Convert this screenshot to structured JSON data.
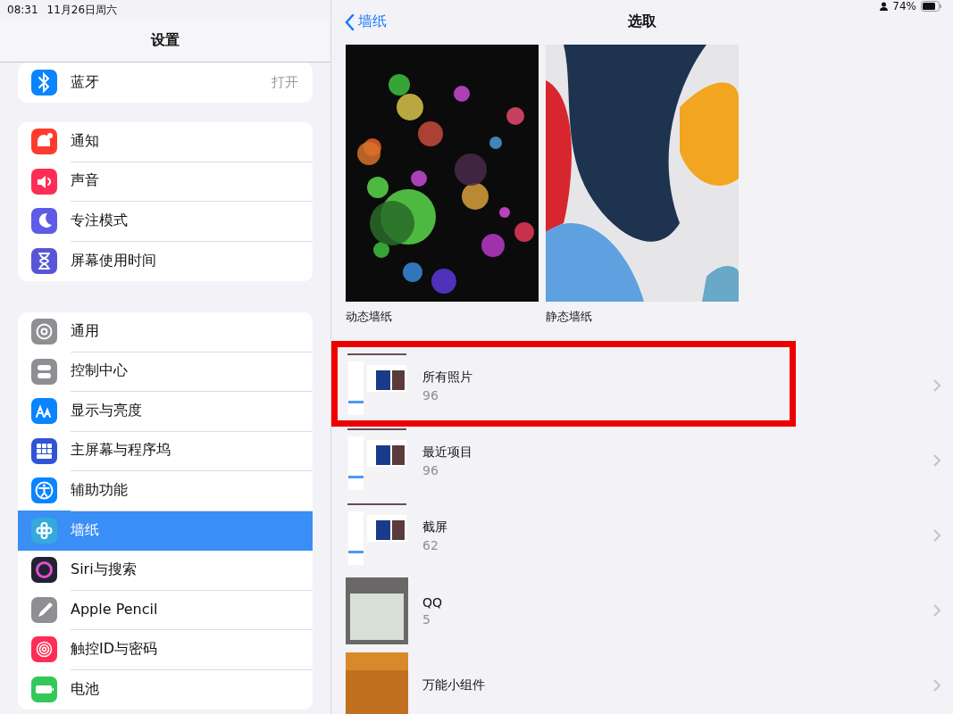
{
  "status_bar": {
    "time": "08:31",
    "date": "11月26日周六",
    "battery": "74%"
  },
  "sidebar": {
    "title": "设置",
    "groups": [
      {
        "items": [
          {
            "label": "蓝牙",
            "value": "打开",
            "color": "#0a84ff",
            "selected": false
          }
        ]
      },
      {
        "items": [
          {
            "label": "通知",
            "color": "#ff3b30",
            "selected": false
          },
          {
            "label": "声音",
            "color": "#ff2d55",
            "selected": false
          },
          {
            "label": "专注模式",
            "color": "#5e5ce6",
            "selected": false
          },
          {
            "label": "屏幕使用时间",
            "color": "#5856d6",
            "selected": false
          }
        ]
      },
      {
        "items": [
          {
            "label": "通用",
            "color": "#8e8e93",
            "selected": false
          },
          {
            "label": "控制中心",
            "color": "#8e8e93",
            "selected": false
          },
          {
            "label": "显示与亮度",
            "color": "#0a84ff",
            "selected": false
          },
          {
            "label": "主屏幕与程序坞",
            "color": "#2f54d6",
            "selected": false
          },
          {
            "label": "辅助功能",
            "color": "#0a84ff",
            "selected": false
          },
          {
            "label": "墙纸",
            "color": "#35a9dc",
            "selected": true
          },
          {
            "label": "Siri与搜索",
            "color": "#222233",
            "selected": false
          },
          {
            "label": "Apple Pencil",
            "color": "#8e8e93",
            "selected": false
          },
          {
            "label": "触控ID与密码",
            "color": "#ff2d55",
            "selected": false
          },
          {
            "label": "电池",
            "color": "#34c759",
            "selected": false
          }
        ]
      }
    ]
  },
  "detail": {
    "back": "墙纸",
    "title": "选取",
    "wallpapers": [
      {
        "kind": "dynamic",
        "label": "动态墙纸"
      },
      {
        "kind": "still",
        "label": "静态墙纸"
      }
    ],
    "albums": [
      {
        "title": "所有照片",
        "count": "96",
        "kind": "screenshot",
        "highlighted": true
      },
      {
        "title": "最近项目",
        "count": "96",
        "kind": "screenshot",
        "highlighted": false
      },
      {
        "title": "截屏",
        "count": "62",
        "kind": "screenshot",
        "highlighted": false
      },
      {
        "title": "QQ",
        "count": "5",
        "kind": "document",
        "highlighted": false
      },
      {
        "title": "万能小组件",
        "kind": "autumn",
        "highlighted": false
      }
    ]
  }
}
